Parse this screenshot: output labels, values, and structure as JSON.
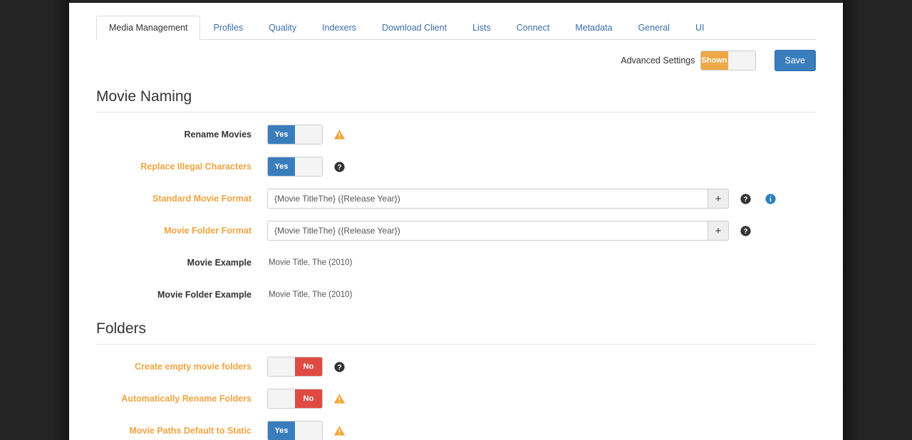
{
  "window": {
    "background_color": "#242424",
    "panel_color": "#ffffff"
  },
  "tabs": [
    {
      "label": "Media Management",
      "active": true
    },
    {
      "label": "Profiles",
      "active": false
    },
    {
      "label": "Quality",
      "active": false
    },
    {
      "label": "Indexers",
      "active": false
    },
    {
      "label": "Download Client",
      "active": false
    },
    {
      "label": "Lists",
      "active": false
    },
    {
      "label": "Connect",
      "active": false
    },
    {
      "label": "Metadata",
      "active": false
    },
    {
      "label": "General",
      "active": false
    },
    {
      "label": "UI",
      "active": false
    }
  ],
  "toolbar": {
    "advanced_settings_label": "Advanced Settings",
    "advanced_settings_state": "Shown",
    "advanced_settings_color": "#eda847",
    "save_label": "Save",
    "save_color": "#3a7dbd"
  },
  "sections": [
    {
      "title": "Movie Naming",
      "rows": [
        {
          "label": "Rename Movies",
          "advanced": false,
          "control": "toggle",
          "value": "Yes",
          "toggle_state": "yes",
          "icons": [
            "warning-icon"
          ]
        },
        {
          "label": "Replace Illegal Characters",
          "advanced": true,
          "control": "toggle",
          "value": "Yes",
          "toggle_state": "yes",
          "icons": [
            "help-icon"
          ]
        },
        {
          "label": "Standard Movie Format",
          "advanced": true,
          "control": "input",
          "value": "{Movie TitleThe} ({Release Year})",
          "placeholder": "",
          "addon": "+",
          "icons": [
            "help-icon",
            "info-icon"
          ]
        },
        {
          "label": "Movie Folder Format",
          "advanced": true,
          "control": "input",
          "value": "{Movie TitleThe} ({Release Year})",
          "placeholder": "",
          "addon": "+",
          "icons": [
            "help-icon"
          ]
        },
        {
          "label": "Movie Example",
          "advanced": false,
          "control": "text",
          "value": "Movie Title, The (2010)",
          "icons": []
        },
        {
          "label": "Movie Folder Example",
          "advanced": false,
          "control": "text",
          "value": "Movie Title, The (2010)",
          "icons": []
        }
      ]
    },
    {
      "title": "Folders",
      "rows": [
        {
          "label": "Create empty movie folders",
          "advanced": true,
          "control": "toggle",
          "value": "No",
          "toggle_state": "no",
          "icons": [
            "help-icon"
          ]
        },
        {
          "label": "Automatically Rename Folders",
          "advanced": true,
          "control": "toggle",
          "value": "No",
          "toggle_state": "no",
          "icons": [
            "warning-icon"
          ]
        },
        {
          "label": "Movie Paths Default to Static",
          "advanced": true,
          "control": "toggle",
          "value": "Yes",
          "toggle_state": "yes",
          "icons": [
            "warning-icon"
          ]
        }
      ]
    }
  ],
  "colors": {
    "toggle_yes": "#3a7dbd",
    "toggle_no": "#df4b42",
    "advanced_label": "#f0a441",
    "warning_icon": "#efa73b",
    "info_icon": "#2a7fc4",
    "tab_link": "#3a6ea8"
  }
}
